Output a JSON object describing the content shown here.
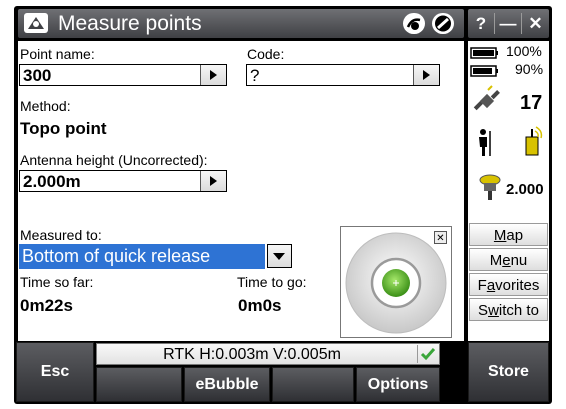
{
  "window": {
    "title": "Measure points",
    "help_label": "?",
    "minimize_label": "—",
    "close_label": "✕"
  },
  "form": {
    "point_name_label": "Point name:",
    "point_name_value": "300",
    "code_label": "Code:",
    "code_value": "?",
    "method_label": "Method:",
    "method_value": "Topo point",
    "antenna_height_label": "Antenna height (Uncorrected):",
    "antenna_height_value": "2.000m",
    "measured_to_label": "Measured to:",
    "measured_to_value": "Bottom of quick release",
    "time_so_far_label": "Time so far:",
    "time_so_far_value": "0m22s",
    "time_to_go_label": "Time to go:",
    "time_to_go_value": "0m0s"
  },
  "bubble": {
    "close_label": "✕"
  },
  "status_panel": {
    "battery_1": "100%",
    "battery_2": "90%",
    "satellites": "17",
    "antenna_height": "2.000"
  },
  "side_buttons": [
    {
      "pre": "",
      "key": "M",
      "post": "ap"
    },
    {
      "pre": "M",
      "key": "e",
      "post": "nu"
    },
    {
      "pre": "F",
      "key": "a",
      "post": "vorites"
    },
    {
      "pre": "S",
      "key": "w",
      "post": "itch to"
    }
  ],
  "status_bar": {
    "text": "RTK H:0.003m V:0.005m"
  },
  "bottom": {
    "esc_label": "Esc",
    "ebubble_label": "eBubble",
    "options_label": "Options",
    "store_label": "Store"
  },
  "icons": {
    "app": "measure-points-icon",
    "receiver": "receiver-icon",
    "wifi_off": "no-connection-icon",
    "battery": "battery-icon",
    "satellite": "satellite-icon",
    "person": "surveyor-icon",
    "radio": "radio-icon",
    "antenna": "antenna-icon",
    "check": "check-icon"
  },
  "colors": {
    "selection": "#2e73d4",
    "check": "#3aa63a",
    "bubble": "#5bbf28"
  }
}
